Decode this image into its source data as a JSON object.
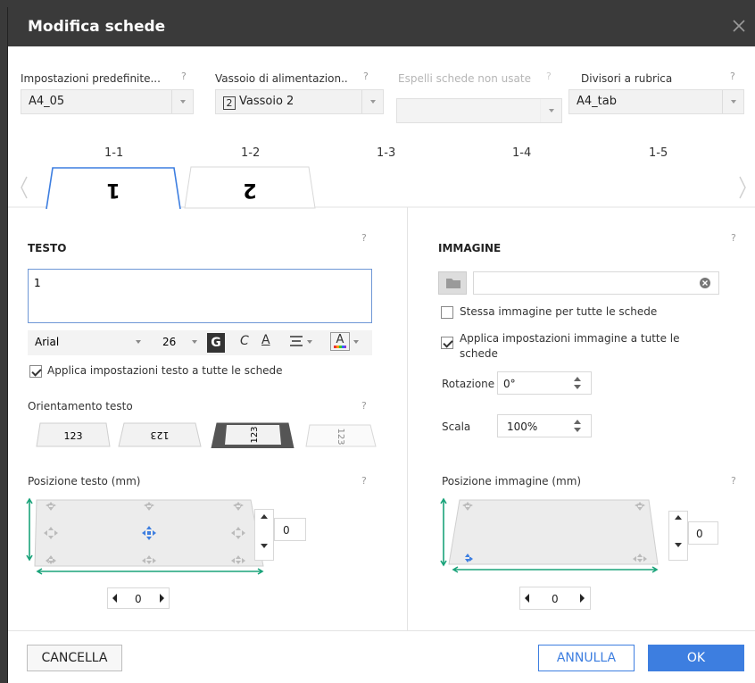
{
  "dialog": {
    "title": "Modifica schede"
  },
  "fields": {
    "preset": {
      "label": "Impostazioni predefinite...",
      "value": "A4_05"
    },
    "tray": {
      "label": "Vassoio di alimentazion...",
      "value": "Vassoio 2",
      "tray_number": "2"
    },
    "eject": {
      "label": "Espelli schede non usate",
      "value": ""
    },
    "dividers": {
      "label": "Divisori a rubrica",
      "value": "A4_tab"
    },
    "help_mark": "?"
  },
  "tabs": {
    "numbers": [
      "1-1",
      "1-2",
      "1-3",
      "1-4",
      "1-5"
    ],
    "labels": [
      "1",
      "2"
    ]
  },
  "text_section": {
    "heading": "TESTO",
    "content": "1",
    "font": "Arial",
    "size": "26",
    "bold": "G",
    "italic": "C",
    "underline": "A",
    "color": "A",
    "apply_all": "Applica impostazioni testo a tutte le schede",
    "orientation_label": "Orientamento testo",
    "orientations": [
      "123",
      "123",
      "123",
      "123"
    ],
    "position_label": "Posizione testo (mm)",
    "offset_y": "0",
    "offset_x": "0"
  },
  "image_section": {
    "heading": "IMMAGINE",
    "same_image": "Stessa immagine per tutte le schede",
    "apply_all_line1": "Applica impostazioni immagine a tutte le",
    "apply_all_line2": "schede",
    "rotation_label": "Rotazione",
    "rotation": "0°",
    "scale_label": "Scala",
    "scale": "100%",
    "position_label": "Posizione immagine (mm)",
    "offset_y": "0",
    "offset_x": "0"
  },
  "footer": {
    "clear": "CANCELLA",
    "cancel": "ANNULLA",
    "ok": "OK"
  },
  "colors": {
    "accent": "#3d7ee0",
    "position_arrow": "#1aa37a",
    "title_bg": "#3a3a3a"
  }
}
